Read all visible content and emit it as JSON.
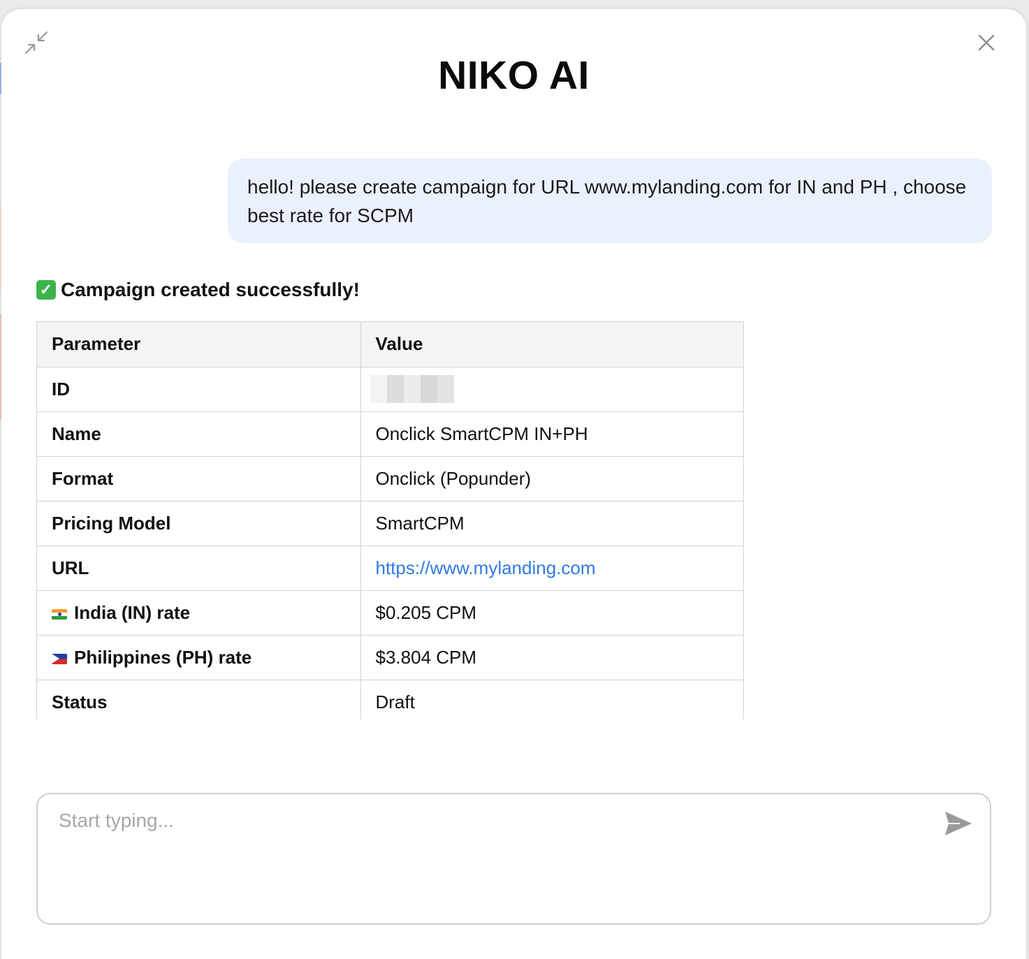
{
  "header": {
    "title": "NIKO AI",
    "minimize_icon": "minimize-arrows-icon",
    "close_icon": "close-icon"
  },
  "messages": {
    "user_text": "hello! please create campaign for URL www.mylanding.com for IN and PH , choose best rate for SCPM",
    "bot_success": "Campaign created successfully!",
    "bot_success_icon": "check-mark-icon"
  },
  "table": {
    "headers": [
      "Parameter",
      "Value"
    ],
    "rows": [
      {
        "param": "ID",
        "value": ""
      },
      {
        "param": "Name",
        "value": "Onclick SmartCPM IN+PH"
      },
      {
        "param": "Format",
        "value": "Onclick (Popunder)"
      },
      {
        "param": "Pricing Model",
        "value": "SmartCPM"
      },
      {
        "param": "URL",
        "value": "https://www.mylanding.com"
      },
      {
        "param": "India (IN) rate",
        "value": "$0.205 CPM",
        "flag": "india-flag-icon"
      },
      {
        "param": "Philippines (PH) rate",
        "value": "$3.804 CPM",
        "flag": "philippines-flag-icon"
      },
      {
        "param": "Status",
        "value": "Draft"
      }
    ]
  },
  "composer": {
    "placeholder": "Start typing...",
    "send_icon": "send-icon"
  },
  "colors": {
    "user_bubble": "#eaf1fd",
    "link": "#2f7ae5",
    "success_check": "#3cb44b"
  }
}
